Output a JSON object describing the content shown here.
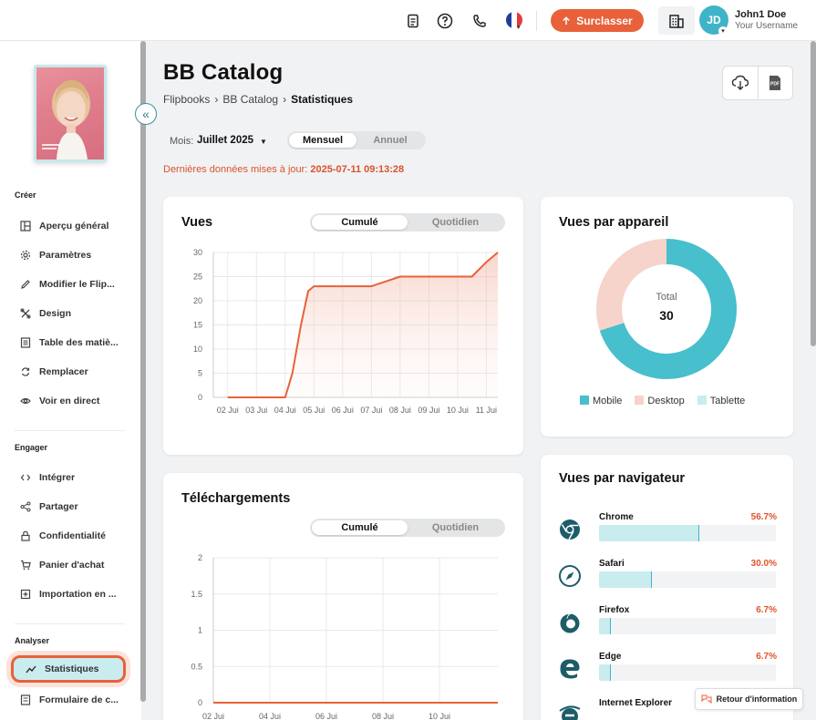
{
  "topbar": {
    "upgrade_label": "Surclasser",
    "avatar_initials": "JD",
    "user_name": "John1 Doe",
    "user_sub": "Your Username"
  },
  "sidebar": {
    "sections": [
      {
        "label": "Créer",
        "items": [
          {
            "label": "Aperçu général",
            "icon": "layout-icon"
          },
          {
            "label": "Paramètres",
            "icon": "gear-icon"
          },
          {
            "label": "Modifier le Flip...",
            "icon": "pencil-icon"
          },
          {
            "label": "Design",
            "icon": "design-tools-icon"
          },
          {
            "label": "Table des matiè...",
            "icon": "table-of-contents-icon"
          },
          {
            "label": "Remplacer",
            "icon": "replace-icon"
          },
          {
            "label": "Voir en direct",
            "icon": "eye-icon"
          }
        ]
      },
      {
        "label": "Engager",
        "items": [
          {
            "label": "Intégrer",
            "icon": "code-icon"
          },
          {
            "label": "Partager",
            "icon": "share-icon"
          },
          {
            "label": "Confidentialité",
            "icon": "lock-icon"
          },
          {
            "label": "Panier d'achat",
            "icon": "cart-icon"
          },
          {
            "label": "Importation en ...",
            "icon": "import-icon"
          }
        ]
      },
      {
        "label": "Analyser",
        "items": [
          {
            "label": "Statistiques",
            "icon": "stats-icon",
            "active": true
          },
          {
            "label": "Formulaire de c...",
            "icon": "form-icon"
          }
        ]
      }
    ]
  },
  "page": {
    "title": "BB Catalog",
    "breadcrumb": [
      "Flipbooks",
      "BB Catalog",
      "Statistiques"
    ],
    "month_label": "Mois:",
    "month_value": "Juillet 2025",
    "period_tabs": [
      "Mensuel",
      "Annuel"
    ],
    "updated_label": "Dernières données mises à jour:",
    "updated_value": "2025-07-11 09:13:28"
  },
  "views_card": {
    "title": "Vues",
    "tabs": [
      "Cumulé",
      "Quotidien"
    ]
  },
  "downloads_card": {
    "title": "Téléchargements",
    "tabs": [
      "Cumulé",
      "Quotidien"
    ]
  },
  "device_card": {
    "title": "Vues par appareil",
    "total_label": "Total",
    "total_value": "30",
    "legend": [
      {
        "name": "Mobile",
        "color": "#47bfcc"
      },
      {
        "name": "Desktop",
        "color": "#f6d3cb"
      },
      {
        "name": "Tablette",
        "color": "#c9ecef"
      }
    ]
  },
  "browser_card": {
    "title": "Vues par navigateur",
    "browsers": [
      {
        "name": "Chrome",
        "pct_label": "56.7%",
        "pct": 56.7,
        "icon": "chrome-icon"
      },
      {
        "name": "Safari",
        "pct_label": "30.0%",
        "pct": 30.0,
        "icon": "safari-icon"
      },
      {
        "name": "Firefox",
        "pct_label": "6.7%",
        "pct": 6.7,
        "icon": "firefox-icon"
      },
      {
        "name": "Edge",
        "pct_label": "6.7%",
        "pct": 6.7,
        "icon": "edge-icon"
      },
      {
        "name": "Internet Explorer",
        "pct_label": "",
        "pct": 0,
        "icon": "ie-icon"
      }
    ]
  },
  "feedback_label": "Retour d'information",
  "chart_data": [
    {
      "type": "area",
      "title": "Vues",
      "x": [
        "02 Jui",
        "03 Jui",
        "04 Jui",
        "05 Jui",
        "06 Jui",
        "07 Jui",
        "08 Jui",
        "09 Jui",
        "10 Jui",
        "11 Jui"
      ],
      "x_days": [
        2,
        2.5,
        3,
        3.5,
        4,
        4.25,
        4.55,
        4.8,
        5,
        6,
        6.5,
        7,
        7.5,
        8,
        9,
        10,
        10.5,
        11,
        11.4
      ],
      "values": [
        0,
        0,
        0,
        0,
        0,
        5,
        15,
        22,
        23,
        23,
        23,
        23,
        24,
        25,
        25,
        25,
        25,
        28,
        30
      ],
      "yticks": [
        0,
        5,
        10,
        15,
        20,
        25,
        30
      ],
      "ylim": [
        0,
        30
      ],
      "color": "#e8613a"
    },
    {
      "type": "line",
      "title": "Téléchargements",
      "x": [
        "02 Jui",
        "04 Jui",
        "06 Jui",
        "08 Jui",
        "10 Jui"
      ],
      "values": [
        0,
        0,
        0,
        0,
        0
      ],
      "yticks": [
        0,
        0.5,
        1,
        1.5,
        2
      ],
      "ylim": [
        0,
        2
      ],
      "color": "#e8613a"
    },
    {
      "type": "pie",
      "title": "Vues par appareil",
      "categories": [
        "Mobile",
        "Desktop",
        "Tablette"
      ],
      "values": [
        70,
        30,
        0
      ],
      "colors": [
        "#47bfcc",
        "#f6d3cb",
        "#c9ecef"
      ]
    }
  ]
}
